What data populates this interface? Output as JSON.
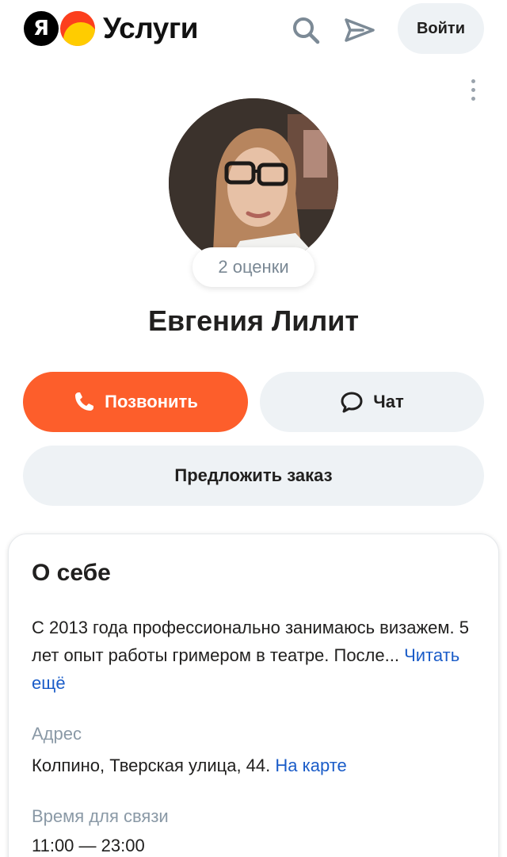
{
  "header": {
    "logo_letter": "Я",
    "brand": "Услуги",
    "login_label": "Войти"
  },
  "profile": {
    "rating_label": "2 оценки",
    "name": "Евгения Лилит"
  },
  "actions": {
    "call_label": "Позвонить",
    "chat_label": "Чат",
    "order_label": "Предложить заказ"
  },
  "about": {
    "title": "О себе",
    "text": "С 2013 года профессионально занимаюсь визажем. 5 лет опыт работы гримером в театре. После...",
    "read_more": "Читать ещё",
    "address_label": "Адрес",
    "address_value": "Колпино, Тверская улица, 44.",
    "map_link": "На карте",
    "contact_time_label": "Время для связи",
    "contact_time_value": "11:00 — 23:00"
  },
  "colors": {
    "accent": "#fd5e2b",
    "link": "#1a5cc8",
    "muted": "#8a99a6",
    "button_bg": "#eef2f5"
  },
  "icons": {
    "search": "search-icon",
    "send": "send-icon",
    "more": "more-vertical-icon",
    "phone": "phone-icon",
    "chat": "chat-bubble-icon"
  }
}
